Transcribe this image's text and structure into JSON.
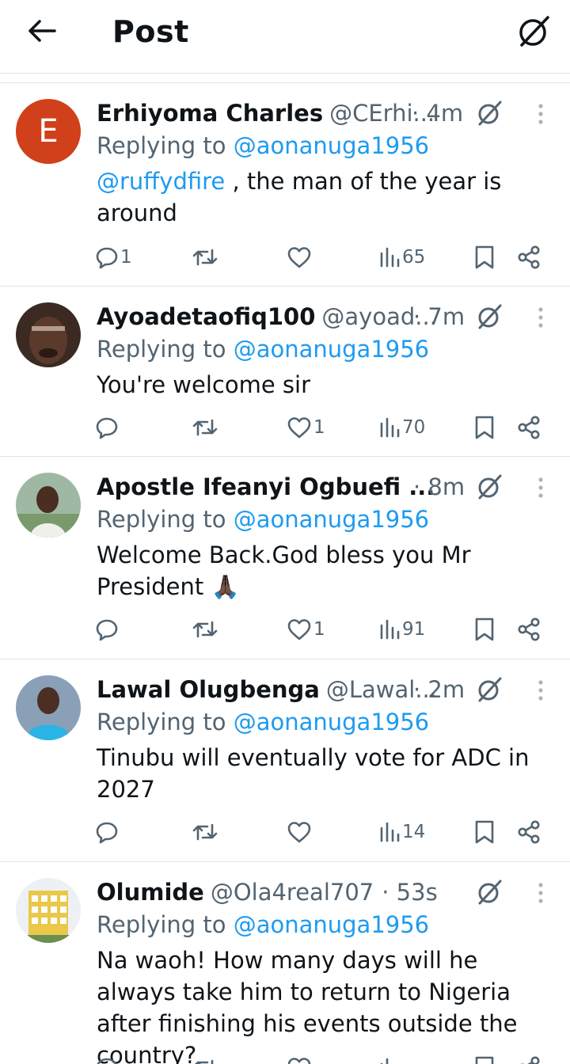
{
  "header": {
    "title": "Post"
  },
  "replies": [
    {
      "name": "Erhiyoma Charles",
      "handle": "@CErhi...",
      "time": "· 4m",
      "replying_prefix": "Replying to",
      "replying_to": "@aonanuga1956",
      "mention": "@ruffydfire",
      "text": " , the man of the year is around",
      "comments": "1",
      "retweets": "",
      "likes": "",
      "views": "65"
    },
    {
      "name": "Ayoadetaofiq100",
      "handle": "@ayoad...",
      "time": "· 7m",
      "replying_prefix": "Replying to",
      "replying_to": "@aonanuga1956",
      "text": "You're welcome sir",
      "comments": "",
      "retweets": "",
      "likes": "1",
      "views": "70"
    },
    {
      "name": "Apostle Ifeanyi Ogbuefi ...",
      "handle": "",
      "time": "· 8m",
      "replying_prefix": "Replying to",
      "replying_to": "@aonanuga1956",
      "text": "Welcome Back.God bless you Mr President 🙏🏿",
      "comments": "",
      "retweets": "",
      "likes": "1",
      "views": "91"
    },
    {
      "name": "Lawal Olugbenga",
      "handle": "@Lawal...",
      "time": "· 2m",
      "replying_prefix": "Replying to",
      "replying_to": "@aonanuga1956",
      "text": "Tinubu will eventually vote for ADC in 2027",
      "comments": "",
      "retweets": "",
      "likes": "",
      "views": "14"
    },
    {
      "name": "Olumide",
      "handle": "@Ola4real707",
      "time": "· 53s",
      "replying_prefix": "Replying to",
      "replying_to": "@aonanuga1956",
      "text": "Na waoh! How many days will he always take him to return to Nigeria after finishing his events outside the country?",
      "comments": "",
      "retweets": "",
      "likes": "",
      "views": ""
    }
  ],
  "avatars": {
    "reply_0_letter": "E"
  },
  "colors": {
    "link": "#1d9bf0",
    "secondary": "#536471",
    "avatar_e": "#d0401a"
  }
}
